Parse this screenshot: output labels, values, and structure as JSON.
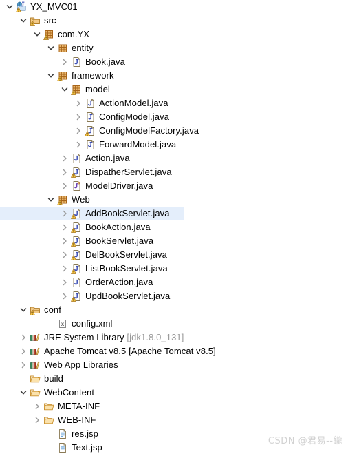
{
  "watermark": "CSDN @君易--鑨",
  "colors": {
    "selection": "#e4eefb",
    "text": "#000000",
    "dim_text": "#9a9a9a",
    "package_icon": "#c87a2f",
    "java_icon": "#3f51b5",
    "folder_icon": "#e8a33d",
    "library_icon": "#2e8b57",
    "warning_badge": "#f0a30a"
  },
  "tree": {
    "rows": [
      {
        "label": "YX_MVC01",
        "depth": 0,
        "twisty": "expanded",
        "icon": "java-project-icon",
        "selected": false
      },
      {
        "label": "src",
        "depth": 1,
        "twisty": "expanded",
        "icon": "source-folder-icon",
        "selected": false
      },
      {
        "label": "com.YX",
        "depth": 2,
        "twisty": "expanded",
        "icon": "package-warning-icon",
        "selected": false
      },
      {
        "label": "entity",
        "depth": 3,
        "twisty": "expanded",
        "icon": "package-icon",
        "selected": false
      },
      {
        "label": "Book.java",
        "depth": 4,
        "twisty": "collapsed",
        "icon": "java-class-icon",
        "selected": false
      },
      {
        "label": "framework",
        "depth": 3,
        "twisty": "expanded",
        "icon": "package-warning-icon",
        "selected": false
      },
      {
        "label": "model",
        "depth": 4,
        "twisty": "expanded",
        "icon": "package-warning-icon",
        "selected": false
      },
      {
        "label": "ActionModel.java",
        "depth": 5,
        "twisty": "collapsed",
        "icon": "java-class-icon",
        "selected": false
      },
      {
        "label": "ConfigModel.java",
        "depth": 5,
        "twisty": "collapsed",
        "icon": "java-class-icon",
        "selected": false
      },
      {
        "label": "ConfigModelFactory.java",
        "depth": 5,
        "twisty": "collapsed",
        "icon": "java-class-warning-icon",
        "selected": false
      },
      {
        "label": "ForwardModel.java",
        "depth": 5,
        "twisty": "collapsed",
        "icon": "java-class-icon",
        "selected": false
      },
      {
        "label": "Action.java",
        "depth": 4,
        "twisty": "collapsed",
        "icon": "java-class-icon",
        "selected": false
      },
      {
        "label": "DispatherServlet.java",
        "depth": 4,
        "twisty": "collapsed",
        "icon": "java-class-warning-icon",
        "selected": false
      },
      {
        "label": "ModelDriver.java",
        "depth": 4,
        "twisty": "collapsed",
        "icon": "java-interface-icon",
        "selected": false
      },
      {
        "label": "Web",
        "depth": 3,
        "twisty": "expanded",
        "icon": "package-warning-icon",
        "selected": false
      },
      {
        "label": "AddBookServlet.java",
        "depth": 4,
        "twisty": "collapsed",
        "icon": "java-class-warning-icon",
        "selected": true
      },
      {
        "label": "BookAction.java",
        "depth": 4,
        "twisty": "collapsed",
        "icon": "java-class-warning-icon",
        "selected": false
      },
      {
        "label": "BookServlet.java",
        "depth": 4,
        "twisty": "collapsed",
        "icon": "java-class-warning-icon",
        "selected": false
      },
      {
        "label": "DelBookServlet.java",
        "depth": 4,
        "twisty": "collapsed",
        "icon": "java-class-warning-icon",
        "selected": false
      },
      {
        "label": "ListBookServlet.java",
        "depth": 4,
        "twisty": "collapsed",
        "icon": "java-class-warning-icon",
        "selected": false
      },
      {
        "label": "OrderAction.java",
        "depth": 4,
        "twisty": "collapsed",
        "icon": "java-class-icon",
        "selected": false
      },
      {
        "label": "UpdBookServlet.java",
        "depth": 4,
        "twisty": "collapsed",
        "icon": "java-class-warning-icon",
        "selected": false
      },
      {
        "label": "conf",
        "depth": 1,
        "twisty": "expanded",
        "icon": "source-folder-icon",
        "selected": false
      },
      {
        "label": "config.xml",
        "depth": 3,
        "twisty": "none",
        "icon": "xml-file-icon",
        "selected": false
      },
      {
        "label": "JRE System Library ",
        "dim": "[jdk1.8.0_131]",
        "depth": 1,
        "twisty": "collapsed",
        "icon": "library-icon",
        "selected": false
      },
      {
        "label": "Apache Tomcat v8.5 [Apache Tomcat v8.5]",
        "depth": 1,
        "twisty": "collapsed",
        "icon": "library-icon",
        "selected": false
      },
      {
        "label": "Web App Libraries",
        "depth": 1,
        "twisty": "collapsed",
        "icon": "library-icon",
        "selected": false
      },
      {
        "label": "build",
        "depth": 1,
        "twisty": "none",
        "icon": "folder-icon",
        "selected": false
      },
      {
        "label": "WebContent",
        "depth": 1,
        "twisty": "expanded",
        "icon": "folder-icon",
        "selected": false
      },
      {
        "label": "META-INF",
        "depth": 2,
        "twisty": "collapsed",
        "icon": "folder-icon",
        "selected": false
      },
      {
        "label": "WEB-INF",
        "depth": 2,
        "twisty": "collapsed",
        "icon": "folder-icon",
        "selected": false
      },
      {
        "label": "res.jsp",
        "depth": 3,
        "twisty": "none",
        "icon": "jsp-file-icon",
        "selected": false
      },
      {
        "label": "Text.jsp",
        "depth": 3,
        "twisty": "none",
        "icon": "jsp-file-icon",
        "selected": false
      }
    ]
  }
}
